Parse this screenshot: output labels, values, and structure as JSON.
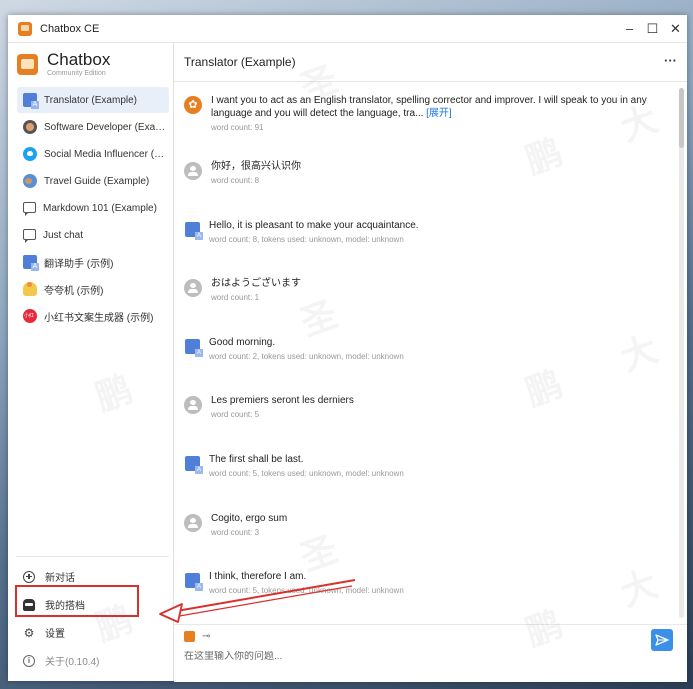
{
  "window": {
    "title": "Chatbox CE",
    "controls": {
      "minimize": "–",
      "maximize": "☐",
      "close": "✕"
    }
  },
  "brand": {
    "name": "Chatbox",
    "edition": "Community Edition"
  },
  "sessions": [
    {
      "label": "Translator (Example)",
      "icon": "translate-icon",
      "active": true
    },
    {
      "label": "Software Developer (Example)",
      "icon": "developer-avatar-icon",
      "active": false
    },
    {
      "label": "Social Media Influencer (Example)",
      "icon": "twitter-icon",
      "active": false
    },
    {
      "label": "Travel Guide (Example)",
      "icon": "globe-icon",
      "active": false
    },
    {
      "label": "Markdown 101 (Example)",
      "icon": "chat-bubble-icon",
      "active": false
    },
    {
      "label": "Just chat",
      "icon": "chat-bubble-icon",
      "active": false
    },
    {
      "label": "翻译助手 (示例)",
      "icon": "translate-icon",
      "active": false
    },
    {
      "label": "夸夸机 (示例)",
      "icon": "cheer-icon",
      "active": false
    },
    {
      "label": "小红书文案生成器 (示例)",
      "icon": "xiaohongshu-icon",
      "active": false
    }
  ],
  "sidebar_bottom": {
    "new_chat": "新对话",
    "my_partners": "我的搭档",
    "settings": "设置",
    "about": "关于(0.10.4)"
  },
  "header": {
    "title": "Translator (Example)",
    "more": "···"
  },
  "messages": [
    {
      "role": "system",
      "text": "I want you to act as an English translator, spelling corrector and improver. I will speak to you in any language and you will detect the language, tra...",
      "expand": "[展开]",
      "meta": "word count: 91"
    },
    {
      "role": "user",
      "text": "你好，很高兴认识你",
      "meta": "word count: 8"
    },
    {
      "role": "assistant",
      "text": "Hello, it is pleasant to make your acquaintance.",
      "meta": "word count: 8, tokens used: unknown, model: unknown"
    },
    {
      "role": "user",
      "text": "おはようございます",
      "meta": "word count: 1"
    },
    {
      "role": "assistant",
      "text": "Good morning.",
      "meta": "word count: 2, tokens used: unknown, model: unknown"
    },
    {
      "role": "user",
      "text": "Les premiers seront les derniers",
      "meta": "word count: 5"
    },
    {
      "role": "assistant",
      "text": "The first shall be last.",
      "meta": "word count: 5, tokens used: unknown, model: unknown"
    },
    {
      "role": "user",
      "text": "Cogito, ergo sum",
      "meta": "word count: 3"
    },
    {
      "role": "assistant",
      "text": "I think, therefore I am.",
      "meta": "word count: 5, tokens used: unknown, model: unknown"
    }
  ],
  "composer": {
    "key_icon": "⊸",
    "placeholder": "在这里输入你的问题..."
  },
  "watermark": [
    "鹏",
    "大",
    "圣"
  ],
  "colors": {
    "accent": "#3a8fe8",
    "annotation": "#d9302c",
    "brand": "#e67e22"
  }
}
